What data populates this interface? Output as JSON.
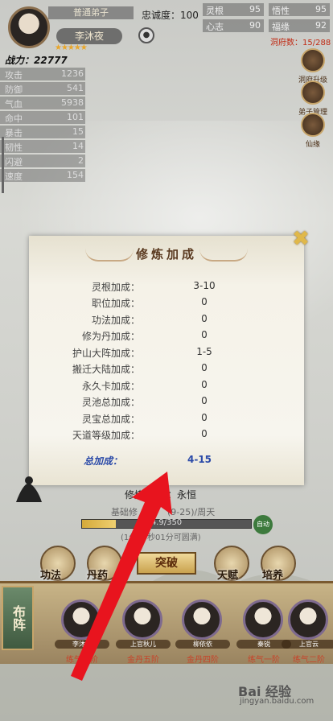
{
  "header": {
    "title": "普通弟子",
    "name": "李沐夜",
    "stars": "★★★★★",
    "loyalty_label": "忠诚度：",
    "loyalty_value": "100",
    "lock_icon": "lock-icon",
    "right_stats": [
      {
        "label": "灵根",
        "value": "95"
      },
      {
        "label": "悟性",
        "value": "95"
      },
      {
        "label": "心志",
        "value": "90"
      },
      {
        "label": "福缘",
        "value": "92"
      }
    ],
    "cave_count": "洞府数：15/288"
  },
  "power": {
    "label": "战力：",
    "value": "22777"
  },
  "stats": [
    {
      "label": "攻击",
      "value": "1236"
    },
    {
      "label": "防御",
      "value": "541"
    },
    {
      "label": "气血",
      "value": "5938"
    },
    {
      "label": "命中",
      "value": "101"
    },
    {
      "label": "暴击",
      "value": "15"
    },
    {
      "label": "韧性",
      "value": "14"
    },
    {
      "label": "闪避",
      "value": "2"
    },
    {
      "label": "速度",
      "value": "154"
    }
  ],
  "side_buttons": [
    {
      "label": "洞府升级"
    },
    {
      "label": "弟子管理"
    },
    {
      "label": "仙缘"
    }
  ],
  "modal": {
    "title": "修炼加成",
    "rows": [
      {
        "label": "灵根加成：",
        "value": "3-10"
      },
      {
        "label": "职位加成：",
        "value": "0"
      },
      {
        "label": "功法加成：",
        "value": "0"
      },
      {
        "label": "修为丹加成：",
        "value": "0"
      },
      {
        "label": "护山大阵加成：",
        "value": "1-5"
      },
      {
        "label": "搬迁大陆加成：",
        "value": "0"
      },
      {
        "label": "永久卡加成：",
        "value": "0"
      },
      {
        "label": "灵池总加成：",
        "value": "0"
      },
      {
        "label": "灵宝总加成：",
        "value": "0"
      },
      {
        "label": "天道等级加成：",
        "value": "0"
      }
    ],
    "total_label": "总加成：",
    "total_value": "4-15",
    "close_icon": "close-icon"
  },
  "cultivation": {
    "label": "修炼",
    "value": "：永恒",
    "base_speed_label": "基础修",
    "base_speed_value": "(9-25)/周天",
    "progress_text": "4.9/350",
    "progress_fraction": 0.2,
    "time_text": "(1分00秒01分可圆满)",
    "auto_label": "自动"
  },
  "actions": {
    "gongfa": "功法",
    "dan": "丹药",
    "breakthrough": "突破",
    "tianfu": "天赋",
    "peiyang": "培养"
  },
  "formation_label": "布阵",
  "disciples": [
    {
      "name": "李沐夜",
      "rank": "练气九阶"
    },
    {
      "name": "上官秋儿",
      "rank": "金丹五阶"
    },
    {
      "name": "柳依依",
      "rank": "金丹四阶"
    },
    {
      "name": "秦锐",
      "rank": "练气一阶"
    },
    {
      "name": "上官云",
      "rank": "练气二阶"
    }
  ],
  "watermark": {
    "brand": "Bai 经验",
    "url": "jingyan.baidu.com"
  }
}
